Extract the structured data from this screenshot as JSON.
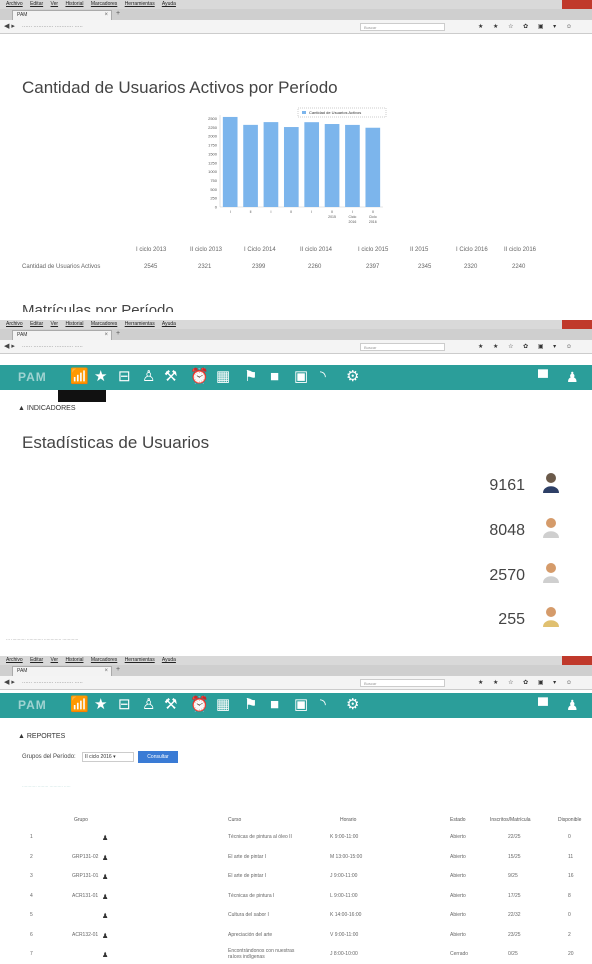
{
  "browser": {
    "menu": [
      "Archivo",
      "Editar",
      "Ver",
      "Historial",
      "Marcadores",
      "Herramientas",
      "Ayuda"
    ],
    "tab_title": "PAM",
    "search_placeholder": "Buscar"
  },
  "section1": {
    "title": "Cantidad de Usuarios Activos por Período",
    "chart_data": {
      "type": "bar",
      "legend": "Cantidad de Usuarios Activos",
      "categories": [
        "I",
        "II",
        "I",
        "II",
        "I",
        "II 2015",
        "I Ciclo 2016",
        "II Ciclo 2016"
      ],
      "values": [
        2545,
        2321,
        2399,
        2260,
        2397,
        2345,
        2320,
        2240
      ],
      "ylim": [
        0,
        2600
      ],
      "yticks": [
        0,
        250,
        500,
        750,
        1000,
        1250,
        1500,
        1750,
        2000,
        2250,
        2500
      ],
      "color": "#7cb5ec"
    },
    "table": {
      "headers": [
        "I ciclo 2013",
        "II ciclo 2013",
        "I Ciclo 2014",
        "II ciclo 2014",
        "I ciclo 2015",
        "II 2015",
        "I Ciclo 2016",
        "II ciclo 2016"
      ],
      "row_label": "Cantidad de Usuarios Activos",
      "values": [
        "2545",
        "2321",
        "2399",
        "2260",
        "2397",
        "2345",
        "2320",
        "2240"
      ]
    },
    "next_heading": "Matrículas por Período"
  },
  "section2": {
    "breadcrumb": "INDICADORES",
    "title": "Estadísticas de Usuarios",
    "stats": [
      "9161",
      "8048",
      "2570",
      "255"
    ]
  },
  "section3": {
    "breadcrumb": "REPORTES",
    "filter_label": "Grupos del Período:",
    "filter_value": "II ciclo 2016",
    "filter_button": "Consultar",
    "headers": [
      "Grupo",
      "Curso",
      "Horario",
      "Estado",
      "Inscritos/Matrícula",
      "Disponible"
    ],
    "rows": [
      {
        "n": "1",
        "grupo": "",
        "curso": "Técnicas de pintura al óleo II",
        "horario": "K 9:00-11:00",
        "estado": "Abierto",
        "inscritos": "22/25",
        "disp": "0"
      },
      {
        "n": "2",
        "grupo": "GRP131-02",
        "curso": "El arte de pintar I",
        "horario": "M 13:00-15:00",
        "estado": "Abierto",
        "inscritos": "15/25",
        "disp": "11"
      },
      {
        "n": "3",
        "grupo": "GRP131-01",
        "curso": "El arte de pintar I",
        "horario": "J 9:00-11:00",
        "estado": "Abierto",
        "inscritos": "9/25",
        "disp": "16"
      },
      {
        "n": "4",
        "grupo": "ACR131-01",
        "curso": "Técnicas de pintura I",
        "horario": "L 9:00-11:00",
        "estado": "Abierto",
        "inscritos": "17/25",
        "disp": "8"
      },
      {
        "n": "5",
        "grupo": "",
        "curso": "Cultura del sabor I",
        "horario": "K 14:00-16:00",
        "estado": "Abierto",
        "inscritos": "22/32",
        "disp": "0"
      },
      {
        "n": "6",
        "grupo": "ACR132-01",
        "curso": "Apreciación del arte",
        "horario": "V 9:00-11:00",
        "estado": "Abierto",
        "inscritos": "23/25",
        "disp": "2"
      },
      {
        "n": "7",
        "grupo": "",
        "curso": "Encontrándonos con nuestras raíces indígenas",
        "horario": "J 8:00-10:00",
        "estado": "Cerrado",
        "inscritos": "0/25",
        "disp": "20"
      }
    ]
  }
}
